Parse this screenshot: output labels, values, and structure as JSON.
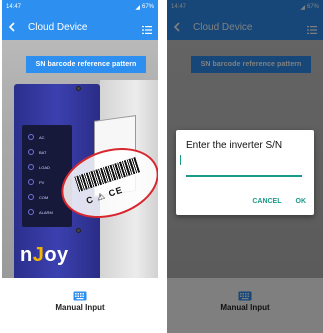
{
  "status_bar": {
    "left": {
      "time": "14:47"
    },
    "right": {
      "time": "14:47"
    },
    "battery_left": "67%",
    "battery_right": "67%"
  },
  "app_bar": {
    "title": "Cloud Device",
    "back_icon": "back-arrow-icon",
    "menu_icon": "list-menu-icon"
  },
  "banner": {
    "label": "SN barcode reference pattern"
  },
  "device": {
    "logo_prefix": "n",
    "logo_accent": "J",
    "logo_suffix": "oy",
    "cert_marks": "C ⚠ CE",
    "led_labels": [
      "AC",
      "BAT",
      "LOAD",
      "PV",
      "COM",
      "ALARM"
    ]
  },
  "bottom": {
    "manual_label": "Manual Input",
    "manual_icon": "keyboard-icon"
  },
  "dialog": {
    "title": "Enter the inverter S/N",
    "input_value": "",
    "cancel_label": "CANCEL",
    "ok_label": "OK"
  },
  "colors": {
    "primary": "#2d8ff0",
    "accent_teal": "#1a9a8a",
    "highlight_red": "#d8262e",
    "device_blue": "#2b2f8c"
  }
}
